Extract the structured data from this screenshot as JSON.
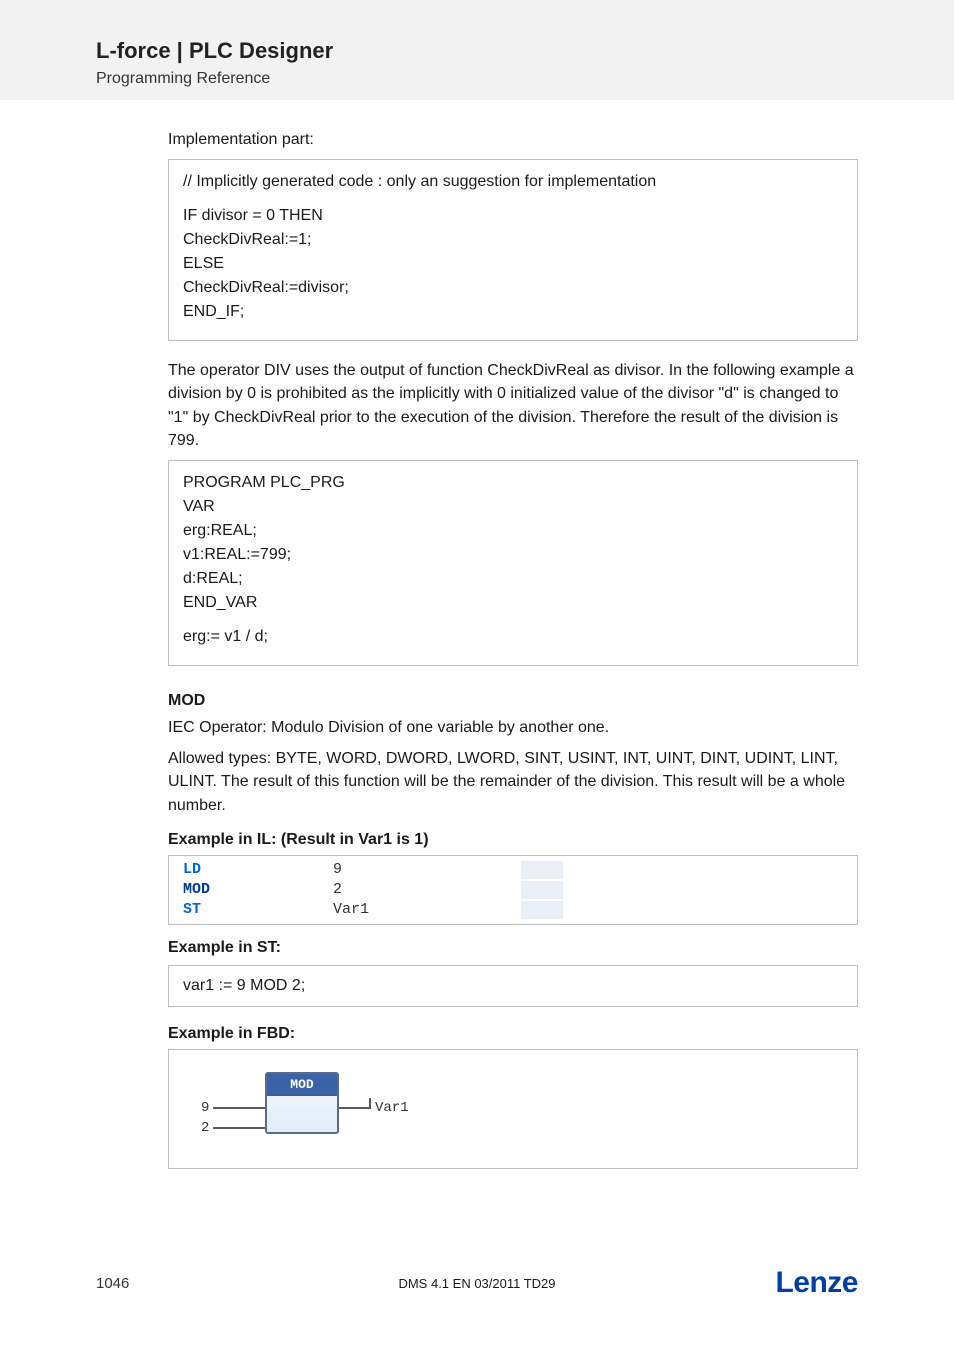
{
  "header": {
    "title": "L-force | PLC Designer",
    "subtitle": "Programming Reference"
  },
  "body": {
    "impl_label": "Implementation part:",
    "code1": {
      "l1": "// Implicitly generated code : only an suggestion for implementation",
      "l2": "IF divisor = 0 THEN",
      "l3": " CheckDivReal:=1;",
      "l4": "ELSE",
      "l5": " CheckDivReal:=divisor;",
      "l6": "END_IF;"
    },
    "explain": "The operator DIV uses the output of function CheckDivReal as divisor. In the following example a division by 0 is prohibited as the implicitly with 0 initialized value of the divisor \"d\" is changed to \"1\" by CheckDivReal prior to the execution of the division. Therefore  the result of the division is 799.",
    "code2": {
      "l1": "PROGRAM PLC_PRG",
      "l2": "VAR",
      "l3": " erg:REAL;",
      "l4": " v1:REAL:=799;",
      "l5": " d:REAL;",
      "l6": "END_VAR",
      "l7": "erg:= v1 / d;"
    },
    "mod_head": "MOD",
    "mod_p1": "IEC Operator: Modulo Division of one variable by another one.",
    "mod_p2": "Allowed types: BYTE, WORD, DWORD, LWORD, SINT, USINT, INT, UINT, DINT, UDINT, LINT, ULINT. The result of this function will be the remainder of the division. This result will be a whole number.",
    "ex_il_head": "Example in IL: (Result in Var1 is 1)",
    "il": {
      "r1": {
        "op": "LD",
        "arg": "9"
      },
      "r2": {
        "op": "MOD",
        "arg": "2"
      },
      "r3": {
        "op": "ST",
        "arg": "Var1"
      }
    },
    "ex_st_head": "Example in ST:",
    "st_code": "var1 := 9 MOD 2;",
    "ex_fbd_head": "Example in FBD:",
    "fbd": {
      "block": "MOD",
      "in1": "9",
      "in2": "2",
      "out": "Var1"
    }
  },
  "footer": {
    "page": "1046",
    "docid": "DMS 4.1 EN 03/2011 TD29",
    "logo": "Lenze"
  }
}
